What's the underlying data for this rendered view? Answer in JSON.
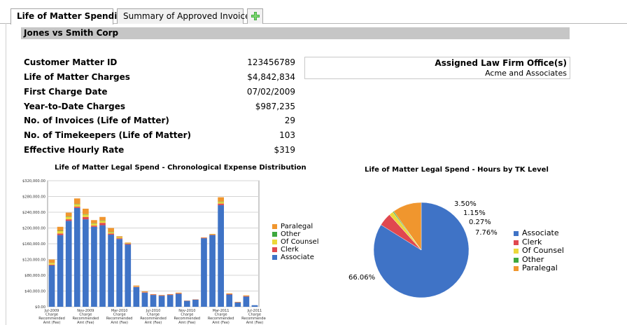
{
  "tabs": [
    {
      "label": "Life of Matter Spending"
    },
    {
      "label": "Summary of Approved Invoices"
    }
  ],
  "matter_title": "Jones vs Smith Corp",
  "summary": [
    {
      "label": "Customer Matter ID",
      "value": "123456789"
    },
    {
      "label": "Life of Matter Charges",
      "value": "$4,842,834"
    },
    {
      "label": "First Charge Date",
      "value": "07/02/2009"
    },
    {
      "label": "Year-to-Date Charges",
      "value": "$987,235"
    },
    {
      "label": "No. of Invoices (Life of Matter)",
      "value": "29"
    },
    {
      "label": "No. of Timekeepers (Life of Matter)",
      "value": "103"
    },
    {
      "label": "Effective Hourly Rate",
      "value": "$319"
    }
  ],
  "office": {
    "header": "Assigned Law Firm Office(s)",
    "value": "Acme and Associates"
  },
  "colors": {
    "associate": "#3f73c6",
    "clerk": "#e0484f",
    "of_counsel": "#ecd83a",
    "other": "#3ea83e",
    "paralegal": "#f0962e"
  },
  "chart_data": [
    {
      "type": "bar",
      "stacked": true,
      "title": "Life of Matter Legal Spend - Chronological Expense Distribution",
      "ylim": [
        0,
        320000
      ],
      "yticks": [
        0,
        40000,
        80000,
        120000,
        160000,
        200000,
        240000,
        280000,
        320000
      ],
      "ytick_labels": [
        "$0.00",
        "$40,000.00",
        "$80,000.00",
        "$120,000.00",
        "$160,000.00",
        "$200,000.00",
        "$240,000.00",
        "$280,000.00",
        "$320,000.00"
      ],
      "x_tick_labels": [
        {
          "index": 0,
          "lines": [
            "Jul-2009",
            "Charge",
            "Recommended",
            "Amt (Fee)"
          ]
        },
        {
          "index": 4,
          "lines": [
            "Nov-2009",
            "Charge",
            "Recommended",
            "Amt (Fee)"
          ]
        },
        {
          "index": 8,
          "lines": [
            "Mar-2010",
            "Charge",
            "Recommended",
            "Amt (Fee)"
          ]
        },
        {
          "index": 12,
          "lines": [
            "Jul-2010",
            "Charge",
            "Recommended",
            "Amt (Fee)"
          ]
        },
        {
          "index": 16,
          "lines": [
            "Nov-2010",
            "Charge",
            "Recommended",
            "Amt (Fee)"
          ]
        },
        {
          "index": 20,
          "lines": [
            "Mar-2011",
            "Charge",
            "Recommended",
            "Amt (Fee)"
          ]
        },
        {
          "index": 24,
          "lines": [
            "Jul-2011",
            "Charge",
            "Recommended",
            "Amt (Fee)"
          ]
        }
      ],
      "legend": [
        "Paralegal",
        "Other",
        "Of Counsel",
        "Clerk",
        "Associate"
      ],
      "series": [
        {
          "name": "Associate",
          "color": "#3f73c6",
          "values": [
            105000,
            182000,
            218000,
            251000,
            222000,
            203000,
            207000,
            183000,
            172000,
            158000,
            50000,
            36000,
            30000,
            28000,
            30000,
            33000,
            15000,
            18000,
            174000,
            182000,
            258000,
            31000,
            11000,
            26000,
            4000
          ]
        },
        {
          "name": "Clerk",
          "color": "#e0484f",
          "values": [
            2000,
            4000,
            4000,
            3000,
            6000,
            3000,
            6000,
            3000,
            2000,
            2000,
            1000,
            1000,
            1000,
            1000,
            1000,
            1000,
            500,
            500,
            1000,
            1000,
            4000,
            1000,
            500,
            1000,
            0
          ]
        },
        {
          "name": "Of Counsel",
          "color": "#ecd83a",
          "values": [
            4000,
            6000,
            6000,
            6000,
            6000,
            5000,
            5000,
            3000,
            2000,
            1000,
            1000,
            0,
            0,
            0,
            0,
            0,
            0,
            0,
            0,
            1000,
            4000,
            0,
            0,
            0,
            0
          ]
        },
        {
          "name": "Other",
          "color": "#3ea83e",
          "values": [
            500,
            1000,
            1000,
            1000,
            1000,
            1000,
            1000,
            1000,
            500,
            500,
            0,
            0,
            0,
            0,
            0,
            0,
            0,
            0,
            0,
            0,
            1000,
            0,
            0,
            0,
            0
          ]
        },
        {
          "name": "Paralegal",
          "color": "#f0962e",
          "values": [
            8500,
            10000,
            10000,
            14000,
            14000,
            8000,
            9000,
            10000,
            2500,
            1500,
            2000,
            2000,
            1000,
            1000,
            1000,
            2000,
            500,
            500,
            1000,
            1000,
            11000,
            2000,
            1000,
            2000,
            0
          ]
        }
      ]
    },
    {
      "type": "pie",
      "title": "Life of Matter Legal Spend - Hours by TK Level",
      "slices": [
        {
          "name": "Associate",
          "value": 66.06,
          "label": "66.06%",
          "color": "#3f73c6"
        },
        {
          "name": "Clerk",
          "value": 3.5,
          "label": "3.50%",
          "color": "#e0484f"
        },
        {
          "name": "Of Counsel",
          "value": 1.15,
          "label": "1.15%",
          "color": "#ecd83a"
        },
        {
          "name": "Other",
          "value": 0.27,
          "label": "0.27%",
          "color": "#3ea83e"
        },
        {
          "name": "Paralegal",
          "value": 7.76,
          "label": "7.76%",
          "color": "#f0962e"
        }
      ],
      "legend": [
        "Associate",
        "Clerk",
        "Of Counsel",
        "Other",
        "Paralegal"
      ]
    }
  ]
}
